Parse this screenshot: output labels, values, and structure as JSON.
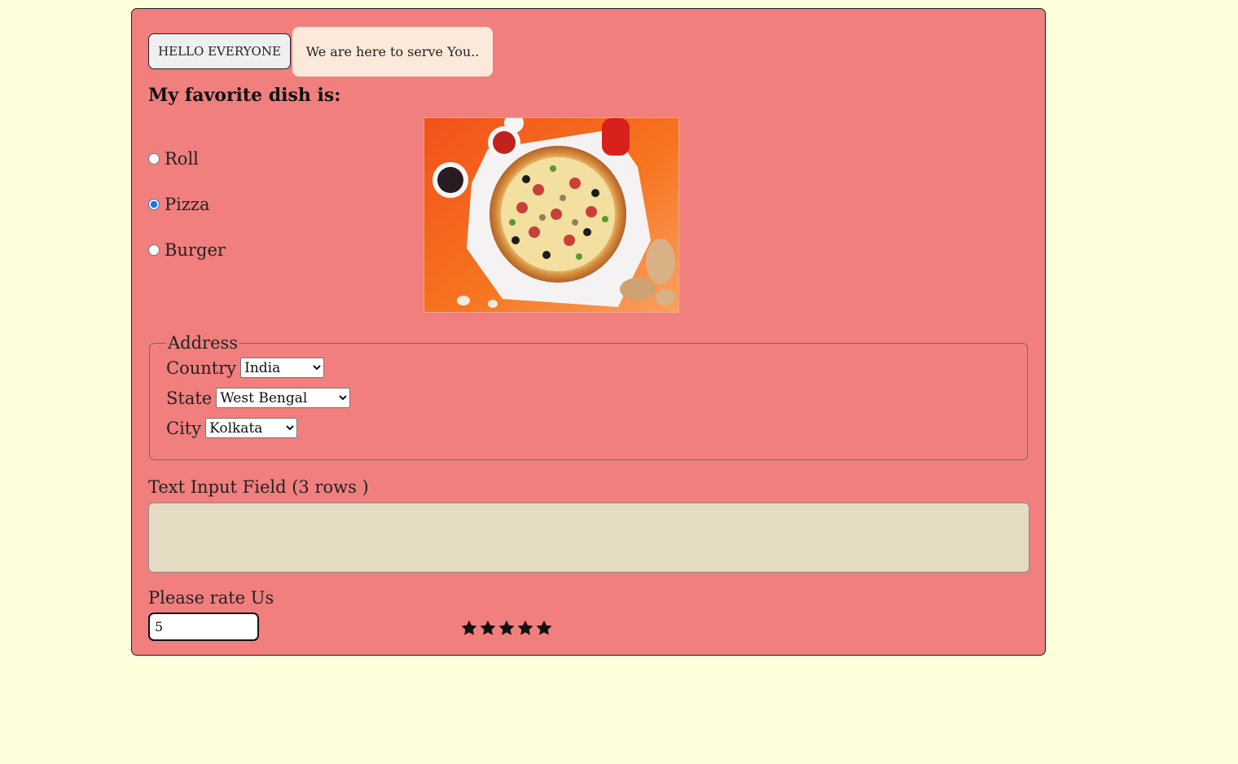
{
  "buttons": {
    "hello": "HELLO EVERYONE",
    "serve": "We are here to serve You.."
  },
  "dish_section": {
    "heading": "My favorite dish is:",
    "options": [
      {
        "label": "Roll",
        "checked": false
      },
      {
        "label": "Pizza",
        "checked": true
      },
      {
        "label": "Burger",
        "checked": false
      }
    ],
    "image_subject": "pizza-photo"
  },
  "address": {
    "legend": "Address",
    "country_label": "Country",
    "country_value": "India",
    "state_label": "State",
    "state_value": "West Bengal",
    "city_label": "City",
    "city_value": "Kolkata"
  },
  "comment": {
    "label": "Text Input Field (3 rows )",
    "value": ""
  },
  "rating": {
    "label": "Please rate Us",
    "value": "5",
    "stars": 5,
    "max_stars": 5
  },
  "colors": {
    "page_background": "#fffedc",
    "card_background": "#f07f7e",
    "textarea_background": "#e6dcc3",
    "serve_button_background": "#fbe9d9",
    "accent": "#1a73e8"
  }
}
